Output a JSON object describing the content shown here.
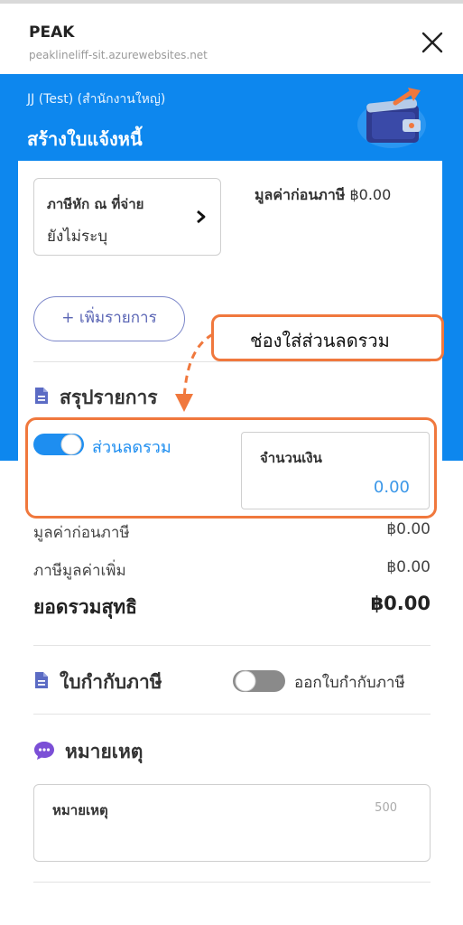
{
  "browser": {
    "app_name": "PEAK",
    "url": "peaklineliff-sit.azurewebsites.net"
  },
  "header": {
    "org": "JJ (Test) (สำนักงานใหญ่)",
    "title": "สร้างใบแจ้งหนี้"
  },
  "withholding": {
    "label": "ภาษีหัก ณ ที่จ่าย",
    "value": "ยังไม่ระบุ"
  },
  "pretax_top": {
    "label": "มูลค่าก่อนภาษี",
    "value": "฿0.00"
  },
  "add_item_label": "+ เพิ่มรายการ",
  "callout_text": "ช่องใส่ส่วนลดรวม",
  "summary": {
    "title": "สรุปรายการ",
    "discount_label": "ส่วนลดรวม",
    "discount_enabled": true,
    "amount_label": "จำนวนเงิน",
    "amount_value": "0.00",
    "rows": [
      {
        "label": "มูลค่าก่อนภาษี",
        "value": "฿0.00"
      },
      {
        "label": "ภาษีมูลค่าเพิ่ม",
        "value": "฿0.00"
      },
      {
        "label": "ยอดรวมสุทธิ",
        "value": "฿0.00"
      }
    ]
  },
  "tax_invoice": {
    "title": "ใบกำกับภาษี",
    "toggle_label": "ออกใบกำกับภาษี",
    "enabled": false
  },
  "notes": {
    "title": "หมายเหตุ",
    "field_label": "หมายเหตุ",
    "char_limit": "500"
  },
  "colors": {
    "primary_blue": "#0d87ee",
    "annotation_orange": "#f0783d",
    "toggle_on": "#1e8ef0",
    "toggle_off": "#8a8a8a"
  }
}
